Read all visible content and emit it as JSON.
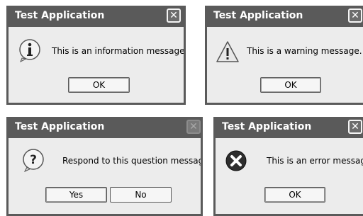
{
  "dialogs": [
    {
      "title": "Test Application",
      "icon": "information-icon",
      "message": "This is an information message.",
      "buttons": [
        "OK"
      ],
      "close_enabled": true
    },
    {
      "title": "Test Application",
      "icon": "warning-icon",
      "message": "This is a warning message.",
      "buttons": [
        "OK"
      ],
      "close_enabled": true
    },
    {
      "title": "Test Application",
      "icon": "question-icon",
      "message": "Respond to this question message?",
      "buttons": [
        "Yes",
        "No"
      ],
      "close_enabled": false
    },
    {
      "title": "Test Application",
      "icon": "error-icon",
      "message": "This is an error message.",
      "buttons": [
        "OK"
      ],
      "close_enabled": true
    }
  ],
  "close_glyph": "✕"
}
